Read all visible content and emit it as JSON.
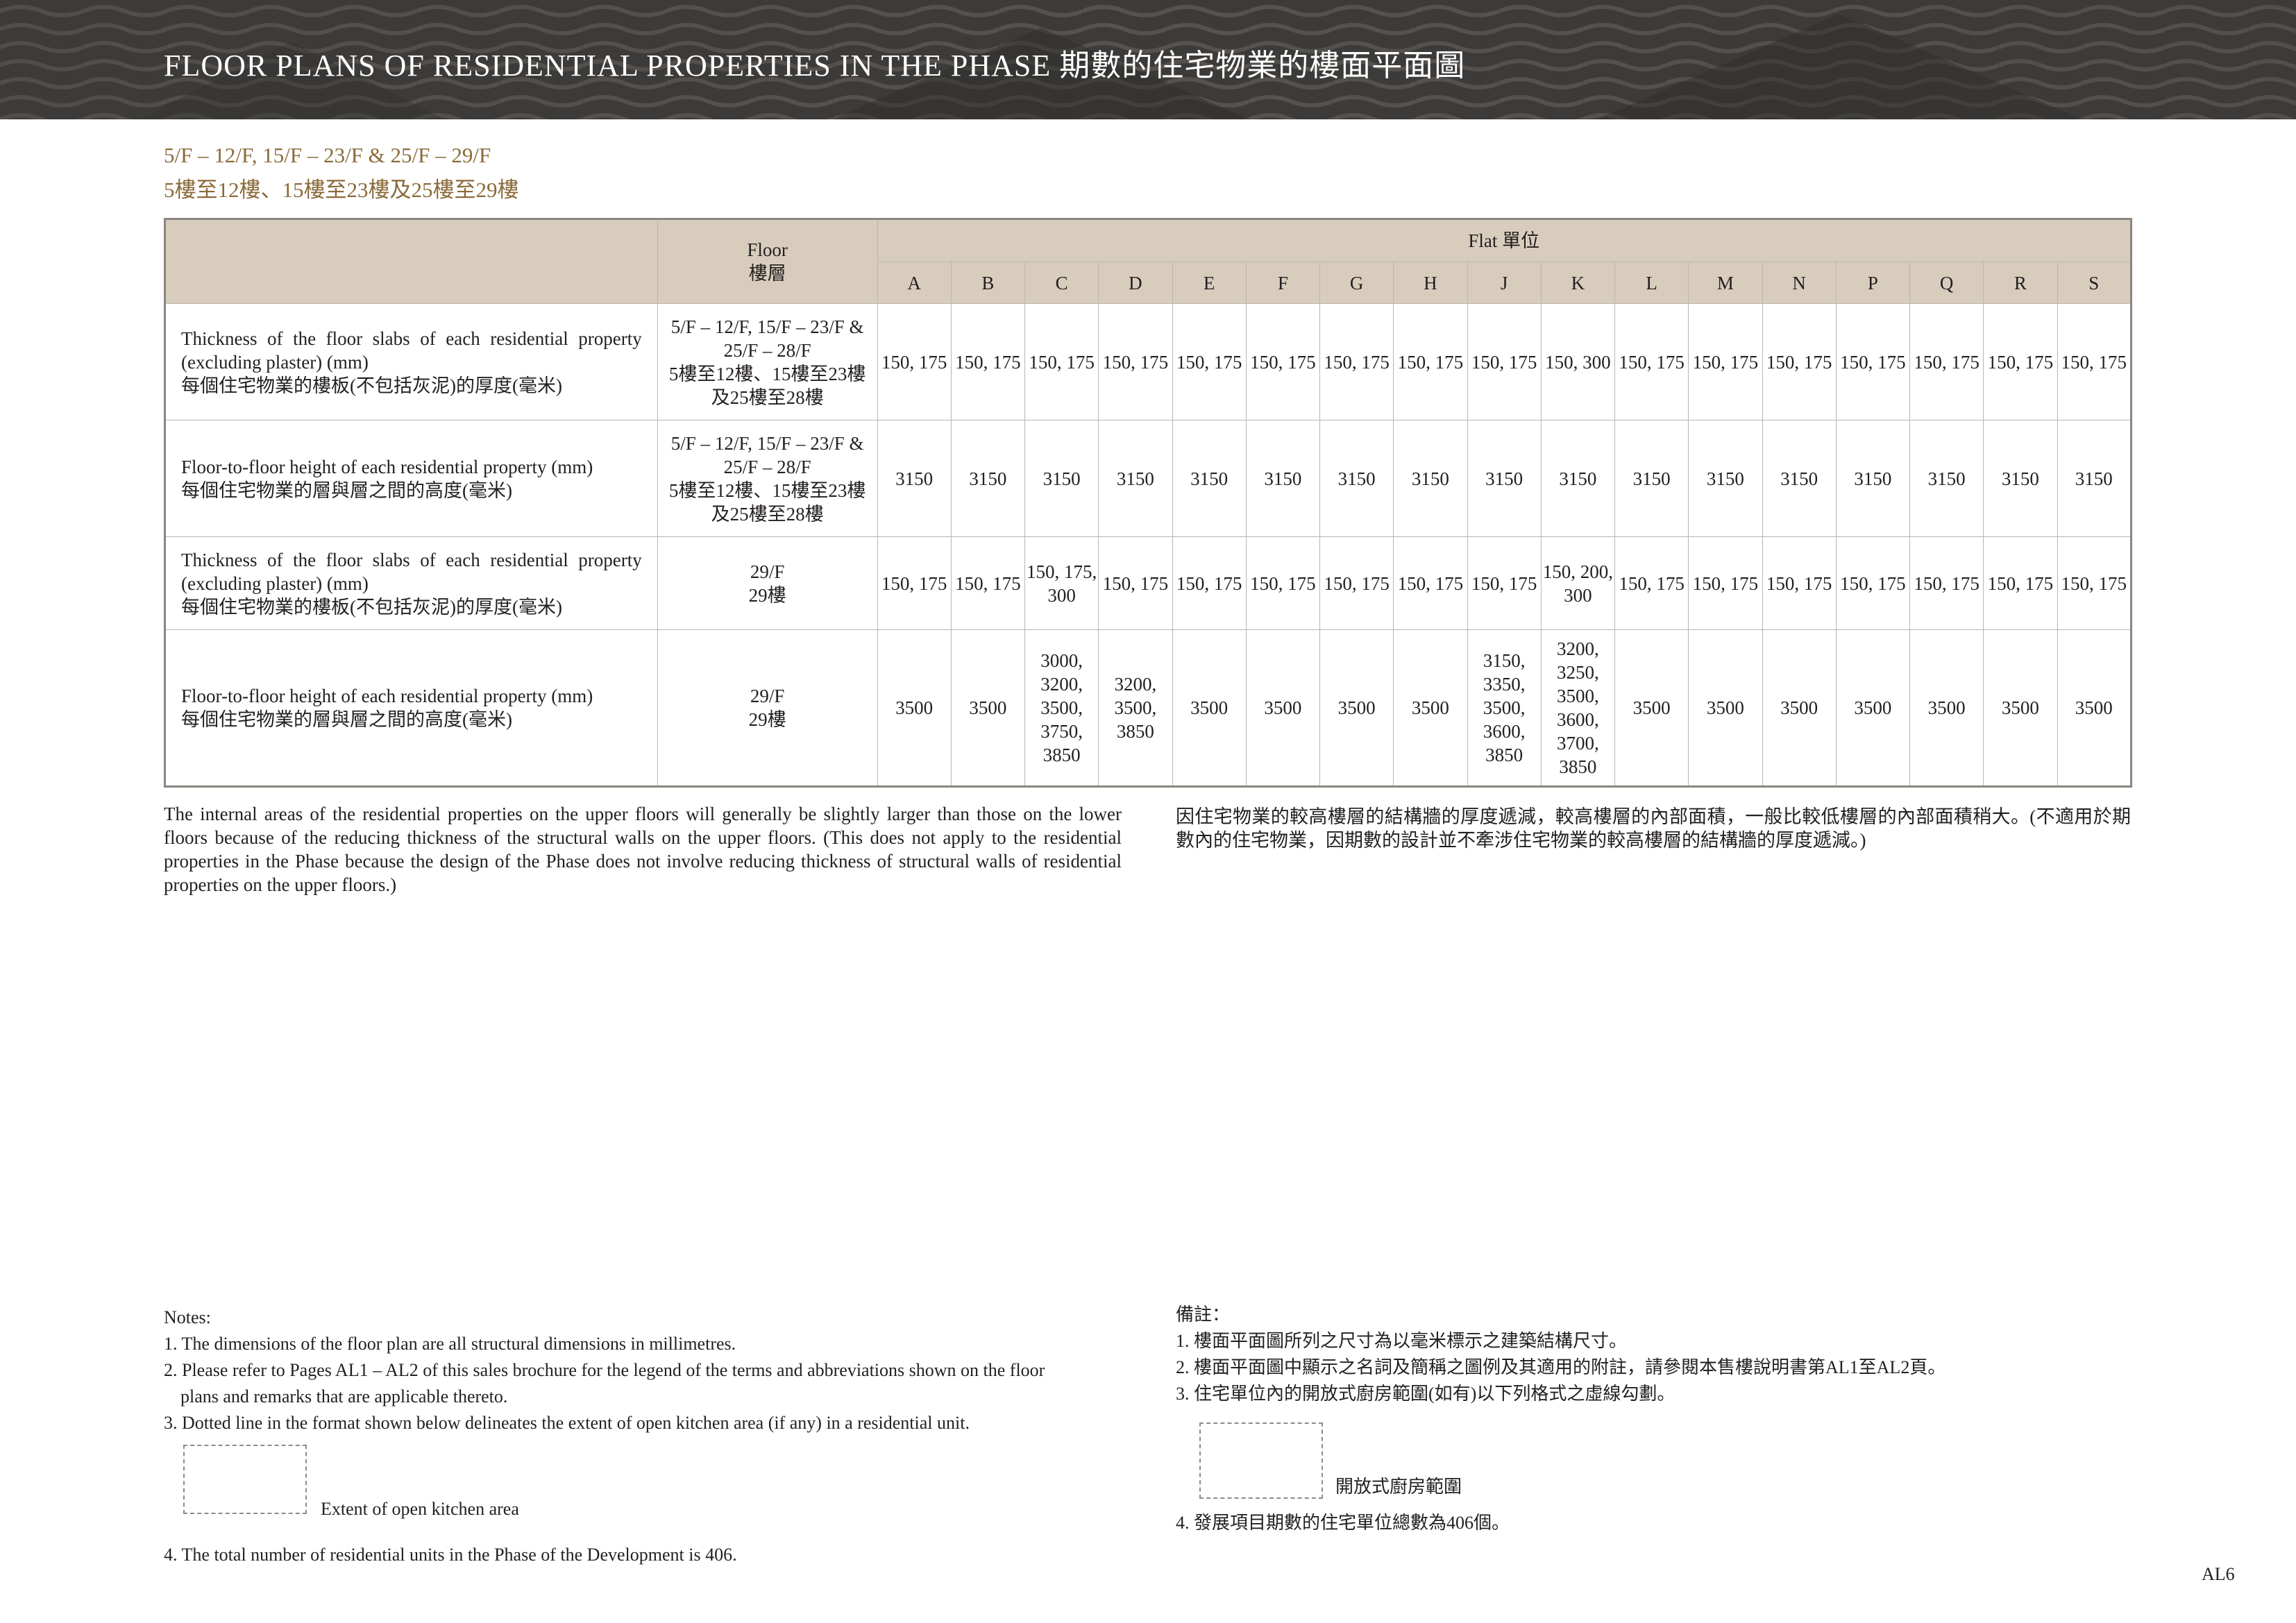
{
  "header": {
    "title": "FLOOR PLANS OF RESIDENTIAL PROPERTIES IN THE PHASE  期數的住宅物業的樓面平面圖"
  },
  "subtitle": {
    "line1": "5/F – 12/F, 15/F – 23/F & 25/F – 29/F",
    "line2": "5樓至12樓、15樓至23樓及25樓至29樓"
  },
  "table": {
    "floor_header_en": "Floor",
    "floor_header_zh": "樓層",
    "flat_header": "Flat 單位",
    "flats": [
      "A",
      "B",
      "C",
      "D",
      "E",
      "F",
      "G",
      "H",
      "J",
      "K",
      "L",
      "M",
      "N",
      "P",
      "Q",
      "R",
      "S"
    ],
    "rows": [
      {
        "desc_en": "Thickness of the floor slabs of each residential property (excluding plaster) (mm)",
        "desc_zh": "每個住宅物業的樓板(不包括灰泥)的厚度(毫米)",
        "floor_en": "5/F – 12/F, 15/F – 23/F & 25/F – 28/F",
        "floor_zh": "5樓至12樓、15樓至23樓及25樓至28樓",
        "values": [
          "150, 175",
          "150, 175",
          "150, 175",
          "150, 175",
          "150, 175",
          "150, 175",
          "150, 175",
          "150, 175",
          "150, 175",
          "150, 300",
          "150, 175",
          "150, 175",
          "150, 175",
          "150, 175",
          "150, 175",
          "150, 175",
          "150, 175"
        ]
      },
      {
        "desc_en": "Floor-to-floor height of each residential property (mm)",
        "desc_zh": "每個住宅物業的層與層之間的高度(毫米)",
        "floor_en": "5/F – 12/F, 15/F – 23/F & 25/F – 28/F",
        "floor_zh": "5樓至12樓、15樓至23樓及25樓至28樓",
        "values": [
          "3150",
          "3150",
          "3150",
          "3150",
          "3150",
          "3150",
          "3150",
          "3150",
          "3150",
          "3150",
          "3150",
          "3150",
          "3150",
          "3150",
          "3150",
          "3150",
          "3150"
        ]
      },
      {
        "desc_en": "Thickness of the floor slabs of each residential property (excluding plaster) (mm)",
        "desc_zh": "每個住宅物業的樓板(不包括灰泥)的厚度(毫米)",
        "floor_en": "29/F",
        "floor_zh": "29樓",
        "values": [
          "150, 175",
          "150, 175",
          "150, 175, 300",
          "150, 175",
          "150, 175",
          "150, 175",
          "150, 175",
          "150, 175",
          "150, 175",
          "150, 200, 300",
          "150, 175",
          "150, 175",
          "150, 175",
          "150, 175",
          "150, 175",
          "150, 175",
          "150, 175"
        ]
      },
      {
        "desc_en": "Floor-to-floor height of each residential property (mm)",
        "desc_zh": "每個住宅物業的層與層之間的高度(毫米)",
        "floor_en": "29/F",
        "floor_zh": "29樓",
        "values": [
          "3500",
          "3500",
          "3000, 3200, 3500, 3750, 3850",
          "3200, 3500, 3850",
          "3500",
          "3500",
          "3500",
          "3500",
          "3150, 3350, 3500, 3600, 3850",
          "3200, 3250, 3500, 3600, 3700, 3850",
          "3500",
          "3500",
          "3500",
          "3500",
          "3500",
          "3500",
          "3500"
        ]
      }
    ]
  },
  "paragraph": {
    "en": "The internal areas of the residential properties on the upper floors will generally be slightly larger than those on the lower floors because of the reducing thickness of the structural walls on the upper floors. (This does not apply to the residential properties in the Phase because the design of the Phase does not involve reducing thickness of structural walls of residential properties on the upper floors.)",
    "zh": "因住宅物業的較高樓層的結構牆的厚度遞減，較高樓層的內部面積，一般比較低樓層的內部面積稍大。(不適用於期數內的住宅物業，因期數的設計並不牽涉住宅物業的較高樓層的結構牆的厚度遞減。)"
  },
  "notes_en": {
    "heading": "Notes:",
    "n1": "1. The dimensions of the floor plan are all structural dimensions in millimetres.",
    "n2a": "2. Please refer to Pages AL1 – AL2 of this sales brochure for the legend of the terms and abbreviations shown on the floor",
    "n2b": "plans and remarks that are applicable thereto.",
    "n3": "3. Dotted line in the format shown below delineates the extent of open kitchen area (if any) in a residential unit.",
    "box_label": "Extent of open kitchen area",
    "n4": "4.  The total number of residential units in the Phase of the Development is 406."
  },
  "notes_zh": {
    "heading": "備註：",
    "n1": "1. 樓面平面圖所列之尺寸為以毫米標示之建築結構尺寸。",
    "n2": "2. 樓面平面圖中顯示之名詞及簡稱之圖例及其適用的附註，請參閱本售樓說明書第AL1至AL2頁。",
    "n3": "3. 住宅單位內的開放式廚房範圍(如有)以下列格式之虛線勾劃。",
    "box_label": "開放式廚房範圍",
    "n4": "4. 發展項目期數的住宅單位總數為406個。"
  },
  "page_number": "AL6"
}
